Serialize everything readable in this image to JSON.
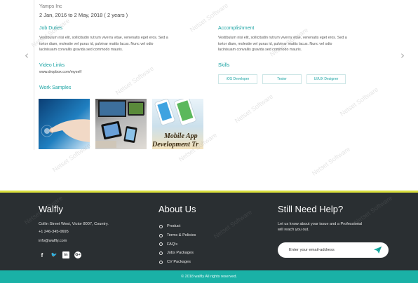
{
  "experience": {
    "company": "Yamps Inc",
    "dates": "2 Jan, 2016 to 2 May, 2018 ( 2 years )",
    "job_duties": {
      "title": "Job Duties",
      "lines": [
        "Vestibulum nisi elit, sollicitudin rutrum viverra vitae, venenatis eget eros. Sed a",
        "tortor diam, molestie vel purus id, pulvinar mattis lacus. Nunc vel odio",
        "lacinisuam convallis gravida sed commodo mauris."
      ]
    },
    "accomplishment": {
      "title": "Accomplishment",
      "lines": [
        "Vestibulum nisi elit, sollicitudin rutrum viverra vitae, venenatis eget eros. Sed a",
        "tortor diam, molestie vel purus id, pulvinar mattis lacus. Nunc vel odio",
        "lacinisuam convallis gravida sed commodo mauris."
      ]
    },
    "video_links": {
      "title": "Video Links",
      "url": "www.dropbox.com/myself"
    },
    "skills": {
      "title": "Skills",
      "items": [
        "iOS Developer",
        "Tester",
        "UI/UX Designer"
      ]
    },
    "work_samples": {
      "title": "Work Samples",
      "sample3_caption_line1": "Mobile App",
      "sample3_caption_line2": "Development Tr"
    },
    "nav": {
      "prev": "‹",
      "next": "›"
    }
  },
  "footer": {
    "brand": {
      "title": "Walfly",
      "address": "Collin Street West, Victor 8007, Country.",
      "phone": "+1 246-345-0695",
      "email": "info@walfly.com"
    },
    "social": {
      "facebook": "f",
      "twitter": "🐦",
      "linkedin": "in",
      "google": "G+"
    },
    "about": {
      "title": "About Us",
      "links": [
        "Product",
        "Terms & Policies",
        "FAQ's",
        "Jobs Packages",
        "CV Packages"
      ]
    },
    "help": {
      "title": "Still Need Help?",
      "line1": "Let us know about your issue and a Professional",
      "line2": "will reach you out.",
      "email_placeholder": "Enter your email-address"
    },
    "copyright": "© 2018 walfly All rights reserved."
  },
  "watermark": "Netset Software",
  "colors": {
    "accent": "#1aa3a3",
    "footer_bg": "#2a2f32",
    "footer_border": "#d9df3c",
    "copyright_bg": "#1ab1a6"
  },
  "icons": {
    "prev": "chevron-left-icon",
    "next": "chevron-right-icon",
    "send": "paper-plane-icon",
    "bullet": "circle-bullet-icon"
  }
}
